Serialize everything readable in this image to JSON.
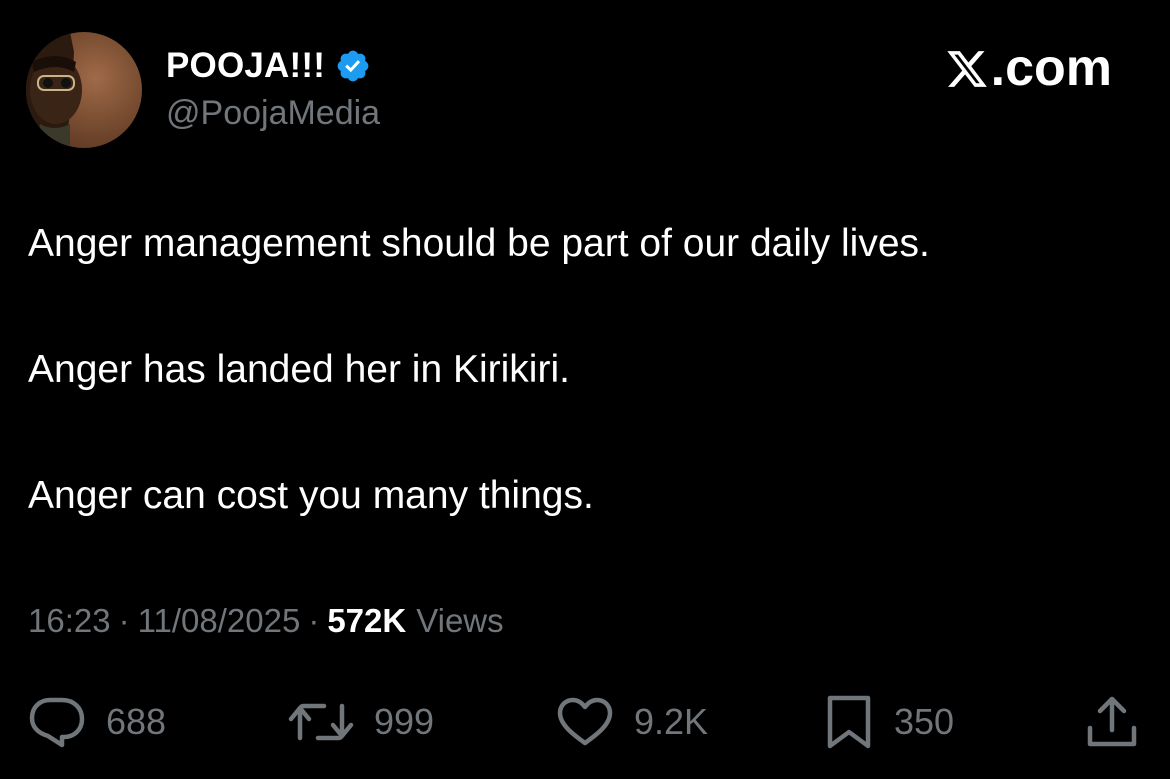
{
  "author": {
    "display_name": "POOJA!!!",
    "handle": "@PoojaMedia",
    "verified_icon": "verified-badge-icon"
  },
  "brand": {
    "label": ".com",
    "logo_icon": "x-logo-icon"
  },
  "tweet": {
    "paragraphs": [
      "Anger management should be part of our daily lives.",
      "Anger has landed her in Kirikiri.",
      "Anger can cost you many things."
    ],
    "time": "16:23",
    "date": "11/08/2025",
    "separator": "·",
    "views_count": "572K",
    "views_label": "Views"
  },
  "actions": {
    "reply": {
      "icon": "reply-icon",
      "count": "688"
    },
    "retweet": {
      "icon": "retweet-icon",
      "count": "999"
    },
    "like": {
      "icon": "heart-icon",
      "count": "9.2K"
    },
    "bookmark": {
      "icon": "bookmark-icon",
      "count": "350"
    },
    "share": {
      "icon": "share-icon"
    }
  },
  "colors": {
    "background": "#000000",
    "primary_text": "#ffffff",
    "secondary_text": "#71767b",
    "verified_blue": "#1d9bf0"
  }
}
